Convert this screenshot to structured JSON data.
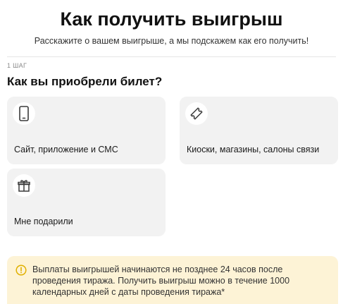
{
  "header": {
    "title": "Как получить выигрыш",
    "subtitle": "Расскажите о вашем выигрыше, а мы подскажем как его получить!"
  },
  "step": {
    "label": "1 ШАГ",
    "question": "Как вы приобрели билет?"
  },
  "options": [
    {
      "label": "Сайт, приложение и СМС",
      "icon": "smartphone-icon"
    },
    {
      "label": "Киоски, магазины, салоны связи",
      "icon": "ticket-icon"
    },
    {
      "label": "Мне подарили",
      "icon": "gift-icon"
    }
  ],
  "notice": {
    "icon": "info-icon",
    "text": "Выплаты выигрышей начинаются не позднее 24 часов после проведения тиража. Получить выигрыш можно в течение 1000 календарных дней с даты проведения тиража*",
    "accent_color": "#f5c400",
    "background_color": "#fdf3d6"
  }
}
